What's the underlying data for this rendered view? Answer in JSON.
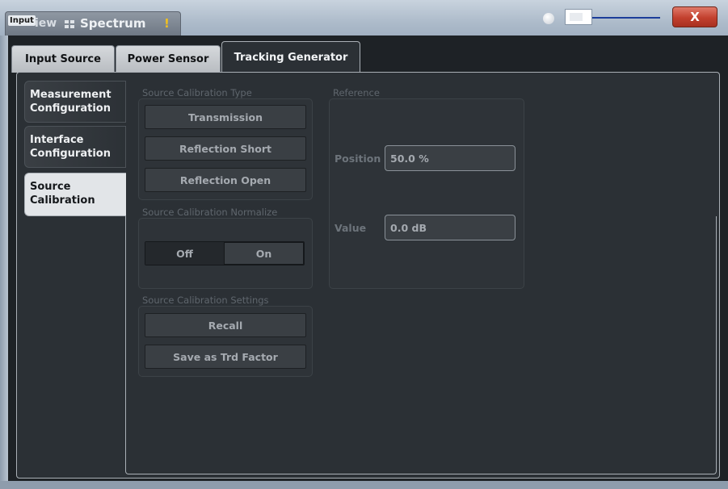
{
  "titlebar": {
    "input_tag": "Input",
    "view_fragment": "iew",
    "tab_label": "Spectrum",
    "warning_symbol": "!",
    "close_symbol": "X"
  },
  "tabs": [
    {
      "label": "Input Source",
      "active": false
    },
    {
      "label": "Power Sensor",
      "active": false
    },
    {
      "label": "Tracking Generator",
      "active": true
    }
  ],
  "side_tabs": [
    {
      "label": "Measurement Configuration",
      "active": false
    },
    {
      "label": "Interface Configuration",
      "active": false
    },
    {
      "label": "Source Calibration",
      "active": true
    }
  ],
  "source_calibration_type": {
    "label": "Source Calibration Type",
    "buttons": [
      "Transmission",
      "Reflection Short",
      "Reflection Open"
    ]
  },
  "normalize": {
    "label": "Source Calibration Normalize",
    "options": [
      "Off",
      "On"
    ],
    "selected": "Off"
  },
  "settings": {
    "label": "Source Calibration Settings",
    "buttons": [
      "Recall",
      "Save as Trd Factor"
    ]
  },
  "reference": {
    "label": "Reference",
    "position_label": "Position",
    "position_value": "50.0 %",
    "value_label": "Value",
    "value_value": "0.0 dB"
  },
  "colors": {
    "close_button": "#c2402e",
    "dialog_background": "#2b3035",
    "active_side_tab": "#e2e5e8"
  }
}
